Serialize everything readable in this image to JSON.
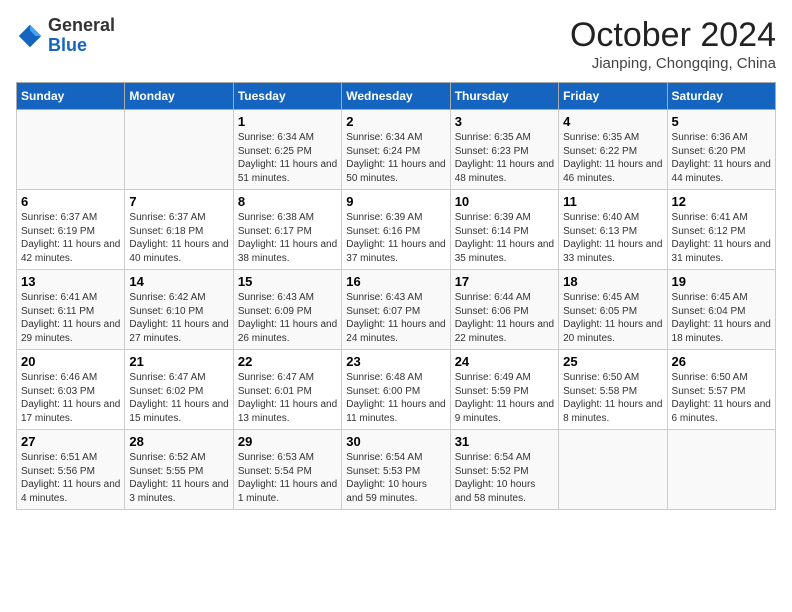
{
  "logo": {
    "general": "General",
    "blue": "Blue"
  },
  "title": "October 2024",
  "subtitle": "Jianping, Chongqing, China",
  "headers": [
    "Sunday",
    "Monday",
    "Tuesday",
    "Wednesday",
    "Thursday",
    "Friday",
    "Saturday"
  ],
  "weeks": [
    [
      {
        "day": "",
        "info": ""
      },
      {
        "day": "",
        "info": ""
      },
      {
        "day": "1",
        "info": "Sunrise: 6:34 AM\nSunset: 6:25 PM\nDaylight: 11 hours and 51 minutes."
      },
      {
        "day": "2",
        "info": "Sunrise: 6:34 AM\nSunset: 6:24 PM\nDaylight: 11 hours and 50 minutes."
      },
      {
        "day": "3",
        "info": "Sunrise: 6:35 AM\nSunset: 6:23 PM\nDaylight: 11 hours and 48 minutes."
      },
      {
        "day": "4",
        "info": "Sunrise: 6:35 AM\nSunset: 6:22 PM\nDaylight: 11 hours and 46 minutes."
      },
      {
        "day": "5",
        "info": "Sunrise: 6:36 AM\nSunset: 6:20 PM\nDaylight: 11 hours and 44 minutes."
      }
    ],
    [
      {
        "day": "6",
        "info": "Sunrise: 6:37 AM\nSunset: 6:19 PM\nDaylight: 11 hours and 42 minutes."
      },
      {
        "day": "7",
        "info": "Sunrise: 6:37 AM\nSunset: 6:18 PM\nDaylight: 11 hours and 40 minutes."
      },
      {
        "day": "8",
        "info": "Sunrise: 6:38 AM\nSunset: 6:17 PM\nDaylight: 11 hours and 38 minutes."
      },
      {
        "day": "9",
        "info": "Sunrise: 6:39 AM\nSunset: 6:16 PM\nDaylight: 11 hours and 37 minutes."
      },
      {
        "day": "10",
        "info": "Sunrise: 6:39 AM\nSunset: 6:14 PM\nDaylight: 11 hours and 35 minutes."
      },
      {
        "day": "11",
        "info": "Sunrise: 6:40 AM\nSunset: 6:13 PM\nDaylight: 11 hours and 33 minutes."
      },
      {
        "day": "12",
        "info": "Sunrise: 6:41 AM\nSunset: 6:12 PM\nDaylight: 11 hours and 31 minutes."
      }
    ],
    [
      {
        "day": "13",
        "info": "Sunrise: 6:41 AM\nSunset: 6:11 PM\nDaylight: 11 hours and 29 minutes."
      },
      {
        "day": "14",
        "info": "Sunrise: 6:42 AM\nSunset: 6:10 PM\nDaylight: 11 hours and 27 minutes."
      },
      {
        "day": "15",
        "info": "Sunrise: 6:43 AM\nSunset: 6:09 PM\nDaylight: 11 hours and 26 minutes."
      },
      {
        "day": "16",
        "info": "Sunrise: 6:43 AM\nSunset: 6:07 PM\nDaylight: 11 hours and 24 minutes."
      },
      {
        "day": "17",
        "info": "Sunrise: 6:44 AM\nSunset: 6:06 PM\nDaylight: 11 hours and 22 minutes."
      },
      {
        "day": "18",
        "info": "Sunrise: 6:45 AM\nSunset: 6:05 PM\nDaylight: 11 hours and 20 minutes."
      },
      {
        "day": "19",
        "info": "Sunrise: 6:45 AM\nSunset: 6:04 PM\nDaylight: 11 hours and 18 minutes."
      }
    ],
    [
      {
        "day": "20",
        "info": "Sunrise: 6:46 AM\nSunset: 6:03 PM\nDaylight: 11 hours and 17 minutes."
      },
      {
        "day": "21",
        "info": "Sunrise: 6:47 AM\nSunset: 6:02 PM\nDaylight: 11 hours and 15 minutes."
      },
      {
        "day": "22",
        "info": "Sunrise: 6:47 AM\nSunset: 6:01 PM\nDaylight: 11 hours and 13 minutes."
      },
      {
        "day": "23",
        "info": "Sunrise: 6:48 AM\nSunset: 6:00 PM\nDaylight: 11 hours and 11 minutes."
      },
      {
        "day": "24",
        "info": "Sunrise: 6:49 AM\nSunset: 5:59 PM\nDaylight: 11 hours and 9 minutes."
      },
      {
        "day": "25",
        "info": "Sunrise: 6:50 AM\nSunset: 5:58 PM\nDaylight: 11 hours and 8 minutes."
      },
      {
        "day": "26",
        "info": "Sunrise: 6:50 AM\nSunset: 5:57 PM\nDaylight: 11 hours and 6 minutes."
      }
    ],
    [
      {
        "day": "27",
        "info": "Sunrise: 6:51 AM\nSunset: 5:56 PM\nDaylight: 11 hours and 4 minutes."
      },
      {
        "day": "28",
        "info": "Sunrise: 6:52 AM\nSunset: 5:55 PM\nDaylight: 11 hours and 3 minutes."
      },
      {
        "day": "29",
        "info": "Sunrise: 6:53 AM\nSunset: 5:54 PM\nDaylight: 11 hours and 1 minute."
      },
      {
        "day": "30",
        "info": "Sunrise: 6:54 AM\nSunset: 5:53 PM\nDaylight: 10 hours and 59 minutes."
      },
      {
        "day": "31",
        "info": "Sunrise: 6:54 AM\nSunset: 5:52 PM\nDaylight: 10 hours and 58 minutes."
      },
      {
        "day": "",
        "info": ""
      },
      {
        "day": "",
        "info": ""
      }
    ]
  ]
}
